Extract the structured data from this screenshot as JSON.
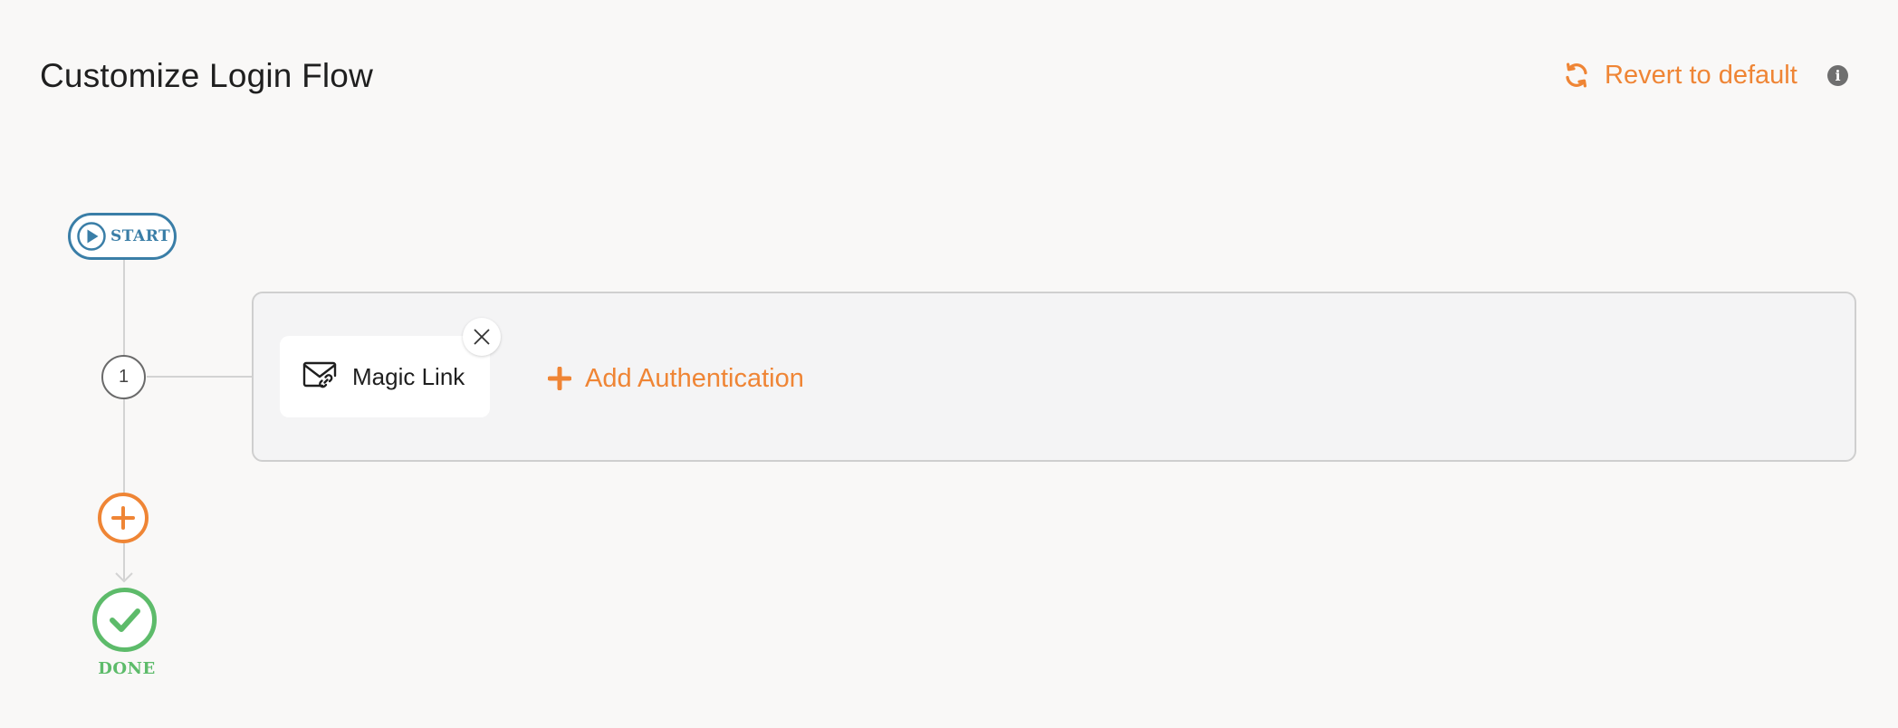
{
  "page": {
    "title": "Customize Login Flow"
  },
  "header": {
    "revert_label": "Revert to default",
    "revert_icon": "refresh-icon",
    "info_icon": "info-icon",
    "info_glyph": "i"
  },
  "flow": {
    "start_label": "START",
    "steps": [
      {
        "number": "1",
        "methods": [
          {
            "label": "Magic Link",
            "icon": "envelope-link-icon"
          }
        ],
        "add_auth_label": "Add Authentication"
      }
    ],
    "done_label": "DONE"
  },
  "colors": {
    "accent": "#ef8535",
    "start": "#3a7ea7",
    "done": "#5dbb6a",
    "rail": "#d3d3d3"
  }
}
